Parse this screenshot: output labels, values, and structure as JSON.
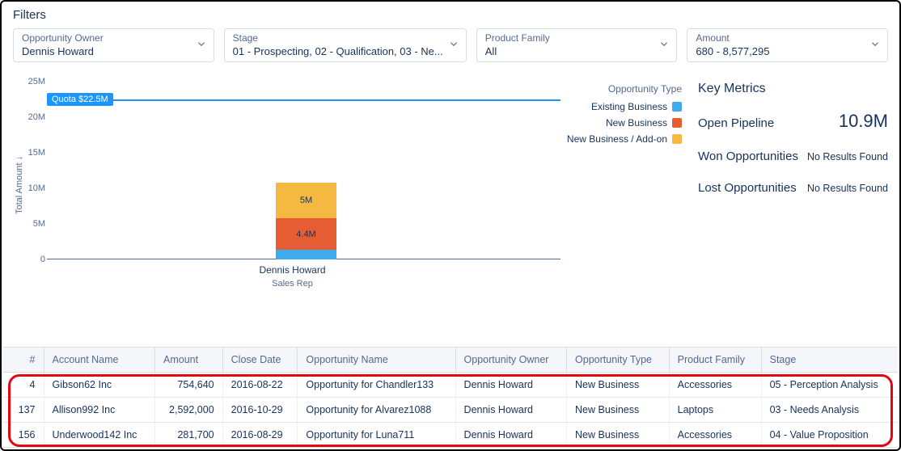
{
  "filters_title": "Filters",
  "filters": [
    {
      "label": "Opportunity Owner",
      "value": "Dennis Howard"
    },
    {
      "label": "Stage",
      "value": "01 - Prospecting, 02 - Qualification, 03 - Ne..."
    },
    {
      "label": "Product Family",
      "value": "All"
    },
    {
      "label": "Amount",
      "value": "680 - 8,577,295"
    }
  ],
  "chart_data": {
    "type": "bar",
    "title": "",
    "ylabel": "Total Amount ↓",
    "xlabel": "Sales Rep",
    "ylim": [
      0,
      25
    ],
    "yticks": [
      "0",
      "5M",
      "10M",
      "15M",
      "20M",
      "25M"
    ],
    "categories": [
      "Dennis Howard"
    ],
    "series": [
      {
        "name": "Existing Business",
        "color": "#3dabec",
        "values": [
          1.4
        ],
        "label": ""
      },
      {
        "name": "New Business",
        "color": "#e65c33",
        "values": [
          4.4
        ],
        "label": "4.4M"
      },
      {
        "name": "New Business / Add-on",
        "color": "#f5b941",
        "values": [
          5.0
        ],
        "label": "5M"
      }
    ],
    "quota": {
      "value": 22.5,
      "label": "Quota $22.5M"
    },
    "legend_title": "Opportunity Type"
  },
  "metrics": {
    "title": "Key Metrics",
    "rows": [
      {
        "label": "Open Pipeline",
        "value": "10.9M",
        "big": true
      },
      {
        "label": "Won Opportunities",
        "value": "No Results Found",
        "big": false
      },
      {
        "label": "Lost Opportunities",
        "value": "No Results Found",
        "big": false
      }
    ]
  },
  "table": {
    "columns": [
      "#",
      "Account Name",
      "Amount",
      "Close Date",
      "Opportunity Name",
      "Opportunity Owner",
      "Opportunity Type",
      "Product Family",
      "Stage"
    ],
    "rows": [
      {
        "num": "4",
        "account": "Gibson62 Inc",
        "amount": "754,640",
        "close": "2016-08-22",
        "opp": "Opportunity for Chandler133",
        "owner": "Dennis Howard",
        "type": "New Business",
        "family": "Accessories",
        "stage": "05 - Perception Analysis"
      },
      {
        "num": "137",
        "account": "Allison992 Inc",
        "amount": "2,592,000",
        "close": "2016-10-29",
        "opp": "Opportunity for Alvarez1088",
        "owner": "Dennis Howard",
        "type": "New Business",
        "family": "Laptops",
        "stage": "03 - Needs Analysis"
      },
      {
        "num": "156",
        "account": "Underwood142 Inc",
        "amount": "281,700",
        "close": "2016-08-29",
        "opp": "Opportunity for Luna711",
        "owner": "Dennis Howard",
        "type": "New Business",
        "family": "Accessories",
        "stage": "04 - Value Proposition"
      }
    ]
  }
}
